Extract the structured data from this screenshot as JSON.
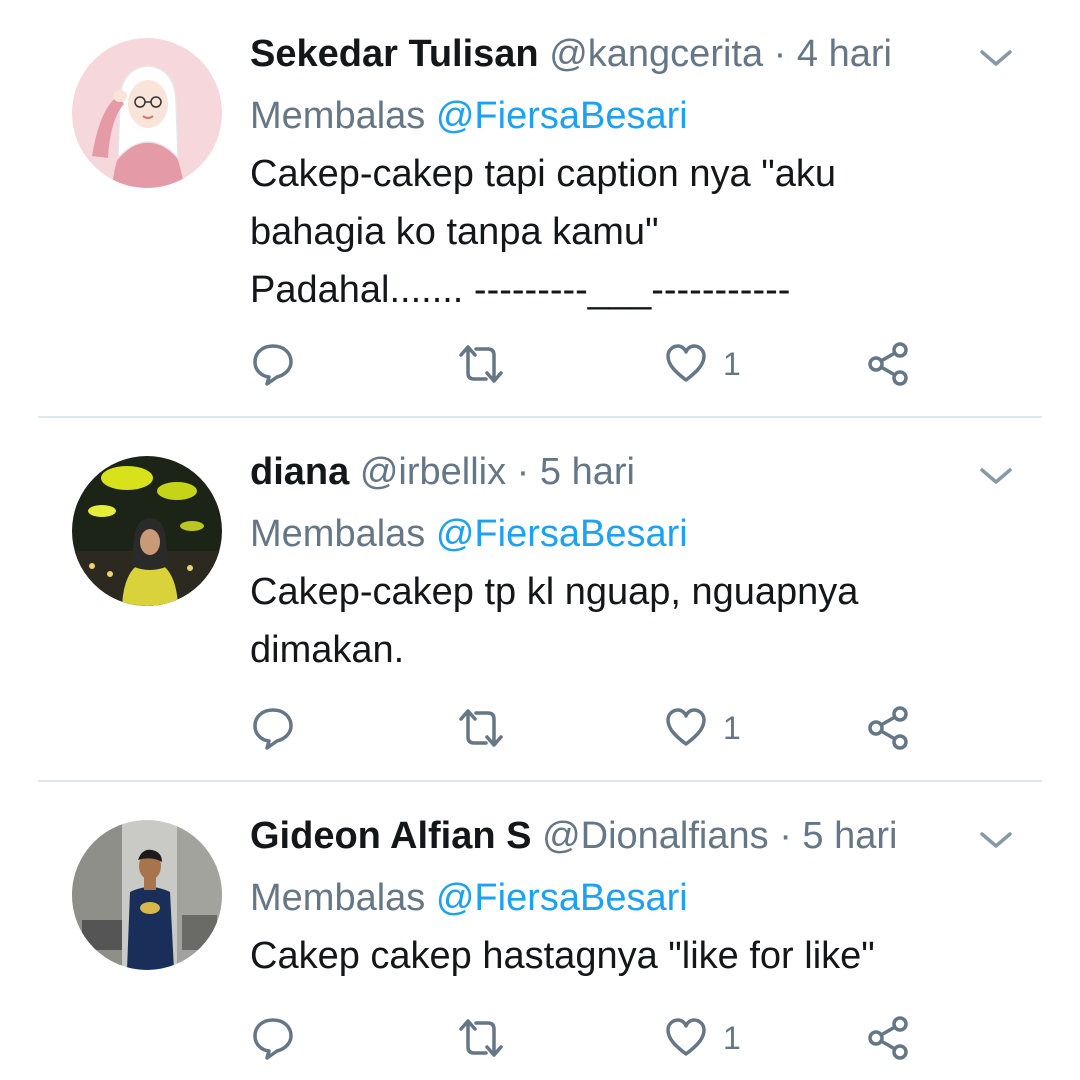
{
  "tweets": [
    {
      "name": "Sekedar Tulisan",
      "handle": "@kangcerita",
      "separator": " · ",
      "time": "4 hari",
      "reply_prefix": "Membalas ",
      "reply_to": "@FiersaBesari",
      "lines": [
        "Cakep-cakep tapi caption nya \"aku",
        "bahagia ko tanpa kamu\"",
        "Padahal....... ---------___-----------"
      ],
      "like_count": "1",
      "avatar_icon": "illustrated-hijab-girl-avatar"
    },
    {
      "name": "diana",
      "handle": "@irbellix",
      "separator": " · ",
      "time": "5 hari",
      "reply_prefix": "Membalas ",
      "reply_to": "@FiersaBesari",
      "lines": [
        "Cakep-cakep tp kl nguap, nguapnya",
        "dimakan."
      ],
      "like_count": "1",
      "avatar_icon": "night-photo-avatar"
    },
    {
      "name": "Gideon Alfian S",
      "handle": "@Dionalfians",
      "separator": " · ",
      "time": "5 hari",
      "reply_prefix": "Membalas ",
      "reply_to": "@FiersaBesari",
      "lines": [
        "Cakep cakep hastagnya \"like for like\""
      ],
      "like_count": "1",
      "avatar_icon": "man-photo-avatar"
    }
  ],
  "icons": {
    "reply": "reply-icon",
    "retweet": "retweet-icon",
    "like": "heart-icon",
    "share": "share-icon",
    "caret": "chevron-down-icon"
  },
  "colors": {
    "name": "#14171a",
    "secondary": "#657786",
    "mention": "#1da1f2",
    "divider": "#e1e8ed"
  }
}
